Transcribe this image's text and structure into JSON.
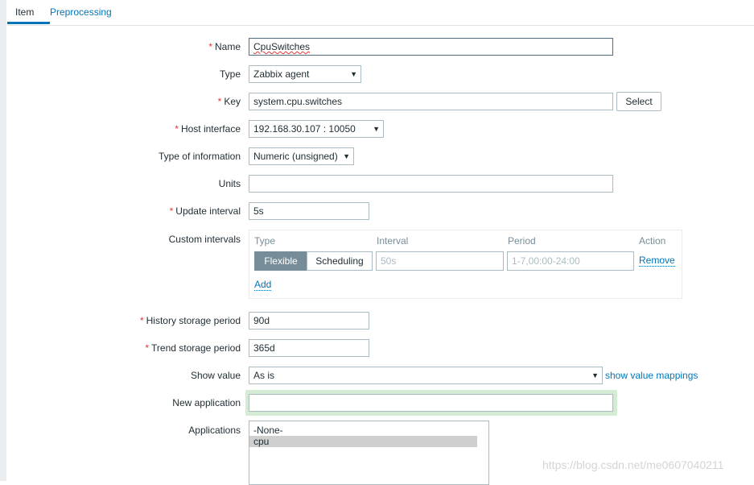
{
  "tabs": [
    {
      "label": "Item"
    },
    {
      "label": "Preprocessing"
    }
  ],
  "required_marker": "*",
  "form": {
    "name": {
      "label": "Name",
      "value": "CpuSwitches"
    },
    "type": {
      "label": "Type",
      "value": "Zabbix agent"
    },
    "key": {
      "label": "Key",
      "value": "system.cpu.switches",
      "select_label": "Select"
    },
    "host_interface": {
      "label": "Host interface",
      "value": "192.168.30.107 : 10050"
    },
    "type_of_information": {
      "label": "Type of information",
      "value": "Numeric (unsigned)"
    },
    "units": {
      "label": "Units",
      "value": ""
    },
    "update_interval": {
      "label": "Update interval",
      "value": "5s"
    },
    "custom_intervals": {
      "label": "Custom intervals",
      "columns": [
        "Type",
        "Interval",
        "Period",
        "Action"
      ],
      "row": {
        "type_options": [
          "Flexible",
          "Scheduling"
        ],
        "interval_placeholder": "50s",
        "period_placeholder": "1-7,00:00-24:00",
        "action": "Remove"
      },
      "add_label": "Add"
    },
    "history_storage_period": {
      "label": "History storage period",
      "value": "90d"
    },
    "trend_storage_period": {
      "label": "Trend storage period",
      "value": "365d"
    },
    "show_value": {
      "label": "Show value",
      "value": "As is",
      "link": "show value mappings"
    },
    "new_application": {
      "label": "New application",
      "value": ""
    },
    "applications": {
      "label": "Applications",
      "options": [
        "-None-",
        "cpu"
      ]
    }
  },
  "watermark": "https://blog.csdn.net/me0607040211"
}
